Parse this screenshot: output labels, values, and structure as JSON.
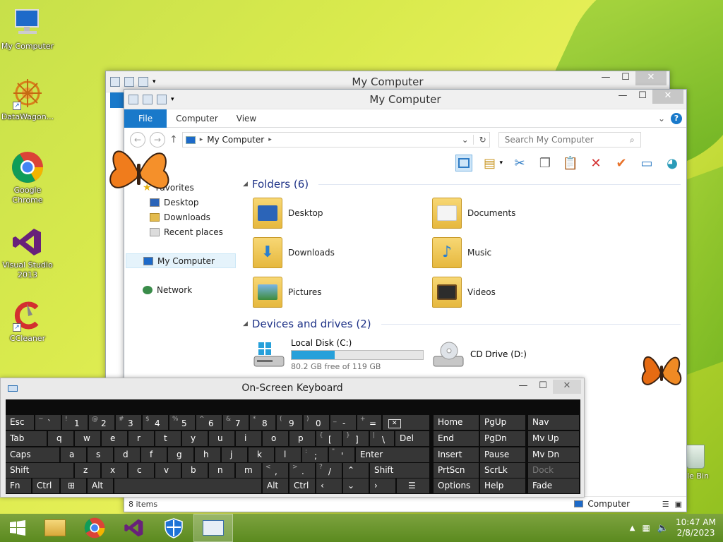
{
  "desktop": {
    "icons": [
      {
        "label": "My Computer"
      },
      {
        "label": "DataWagon..."
      },
      {
        "label": "Google Chrome"
      },
      {
        "label": "Visual Studio 2013"
      },
      {
        "label": "CCleaner"
      }
    ],
    "recycle_bin_label": "cle Bin"
  },
  "back_window": {
    "title": "My Computer"
  },
  "explorer": {
    "title": "My Computer",
    "ribbon": {
      "file": "File",
      "tabs": [
        "Computer",
        "View"
      ],
      "help": "?"
    },
    "address": {
      "location": "My Computer"
    },
    "search": {
      "placeholder": "Search My Computer"
    },
    "nav": {
      "favorites": "Favorites",
      "desktop": "Desktop",
      "downloads": "Downloads",
      "recent": "Recent places",
      "mycomputer": "My Computer",
      "network": "Network"
    },
    "folders_header": "Folders (6)",
    "folders": [
      "Desktop",
      "Documents",
      "Downloads",
      "Music",
      "Pictures",
      "Videos"
    ],
    "drives_header": "Devices and drives (2)",
    "drives": {
      "c_name": "Local Disk (C:)",
      "c_free": "80.2 GB free of 119 GB",
      "c_used_fraction": 0.33,
      "d_name": "CD Drive (D:)"
    },
    "status": {
      "items": "8 items",
      "computer": "Computer"
    }
  },
  "osk": {
    "title": "On-Screen Keyboard",
    "keys": {
      "esc": "Esc",
      "tab": "Tab",
      "caps": "Caps",
      "shift": "Shift",
      "fn": "Fn",
      "ctrl": "Ctrl",
      "alt": "Alt",
      "del": "Del",
      "enter": "Enter",
      "shift_r": "Shift",
      "alt_r": "Alt",
      "ctrl_r": "Ctrl",
      "home": "Home",
      "pgup": "PgUp",
      "nav": "Nav",
      "end": "End",
      "pgdn": "PgDn",
      "mvup": "Mv Up",
      "insert": "Insert",
      "pause": "Pause",
      "mvdn": "Mv Dn",
      "prtscn": "PrtScn",
      "scrlk": "ScrLk",
      "dock": "Dock",
      "options": "Options",
      "help": "Help",
      "fade": "Fade",
      "q": "q",
      "w": "w",
      "e": "e",
      "r": "r",
      "t": "t",
      "y": "y",
      "u": "u",
      "i": "i",
      "o": "o",
      "p": "p",
      "a": "a",
      "s": "s",
      "d": "d",
      "f": "f",
      "g": "g",
      "h": "h",
      "j": "j",
      "k": "k",
      "l": "l",
      "z": "z",
      "x": "x",
      "c": "c",
      "v": "v",
      "b": "b",
      "n": "n",
      "m": "m",
      "lb": "[",
      "rb": "]",
      "bs": "\\",
      "semi": ";",
      "quote": "'",
      "comma": ",",
      "period": ".",
      "slash": "/",
      "n1": "1",
      "n2": "2",
      "n3": "3",
      "n4": "4",
      "n5": "5",
      "n6": "6",
      "n7": "7",
      "n8": "8",
      "n9": "9",
      "n0": "0",
      "minus": "-",
      "eq": "=",
      "tilde": "`",
      "s1": "!",
      "s2": "@",
      "s3": "#",
      "s4": "$",
      "s5": "%",
      "s6": "^",
      "s7": "&",
      "s8": "*",
      "s9": "(",
      "s0": ")",
      "sminus": "_",
      "seq": "+",
      "stilde": "~",
      "slb": "{",
      "srb": "}",
      "sbs": "|",
      "ssemi": ":",
      "squote": "\"",
      "scomma": "<",
      "speriod": ">",
      "sslash": "?"
    }
  },
  "taskbar": {
    "time": "10:47 AM",
    "date": "2/8/2023"
  },
  "colors": {
    "accent": "#1979ca",
    "osk_key": "#363636"
  }
}
